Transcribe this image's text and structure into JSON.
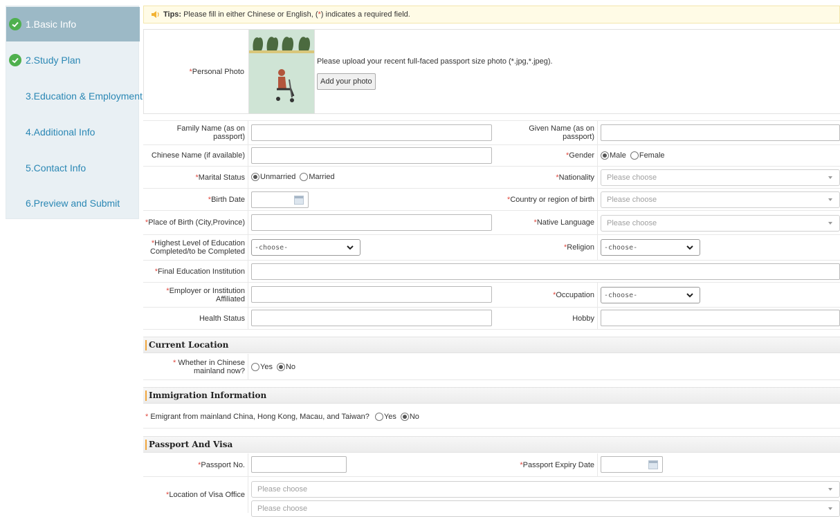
{
  "sidebar": {
    "items": [
      {
        "label": "1.Basic Info",
        "done": true,
        "active": true
      },
      {
        "label": "2.Study Plan",
        "done": true,
        "active": false
      },
      {
        "label": "3.Education & Employment",
        "done": false,
        "active": false
      },
      {
        "label": "4.Additional Info",
        "done": false,
        "active": false
      },
      {
        "label": "5.Contact Info",
        "done": false,
        "active": false
      },
      {
        "label": "6.Preview and Submit",
        "done": false,
        "active": false
      }
    ]
  },
  "tips": {
    "label": "Tips:",
    "text_before": "Please fill in either Chinese or English, (",
    "star": "*",
    "text_after": ") indicates a required field."
  },
  "required_marker": "*",
  "photo": {
    "label": "Personal Photo",
    "instruction": "Please upload your recent full-faced passport size photo (*.jpg,*.jpeg).",
    "button": "Add your photo"
  },
  "form": {
    "family_name": {
      "label": "Family Name (as on passport)",
      "value": ""
    },
    "given_name": {
      "label": "Given Name (as on passport)",
      "value": ""
    },
    "chinese_name": {
      "label": "Chinese Name (if available)",
      "value": ""
    },
    "gender": {
      "label": "Gender",
      "options": [
        "Male",
        "Female"
      ],
      "selected": "Male"
    },
    "marital_status": {
      "label": "Marital Status",
      "options": [
        "Unmarried",
        "Married"
      ],
      "selected": "Unmarried"
    },
    "nationality": {
      "label": "Nationality",
      "placeholder": "Please choose"
    },
    "birth_date": {
      "label": "Birth Date",
      "value": ""
    },
    "country_of_birth": {
      "label": "Country or region of birth",
      "placeholder": "Please choose"
    },
    "place_of_birth": {
      "label": "Place of Birth (City,Province)",
      "value": ""
    },
    "native_language": {
      "label": "Native Language",
      "placeholder": "Please choose"
    },
    "education_level": {
      "label": "Highest Level of Education Completed/to be Completed",
      "value": "-choose-"
    },
    "religion": {
      "label": "Religion",
      "value": "-choose-"
    },
    "final_institution": {
      "label": "Final Education Institution",
      "value": ""
    },
    "employer": {
      "label": "Employer or Institution Affiliated",
      "value": ""
    },
    "occupation": {
      "label": "Occupation",
      "value": "-choose-"
    },
    "health_status": {
      "label": "Health Status",
      "value": ""
    },
    "hobby": {
      "label": "Hobby",
      "value": ""
    }
  },
  "current_location": {
    "title": "Current Location",
    "question": "Whether in Chinese mainland now?",
    "options": [
      "Yes",
      "No"
    ],
    "selected": "No"
  },
  "immigration": {
    "title": "Immigration Information",
    "question": "Emigrant from mainland China, Hong Kong, Macau, and Taiwan?",
    "options": [
      "Yes",
      "No"
    ],
    "selected": "No"
  },
  "passport": {
    "title": "Passport And Visa",
    "passport_no": {
      "label": "Passport No.",
      "value": ""
    },
    "expiry": {
      "label": "Passport Expiry Date",
      "value": ""
    },
    "visa_office": {
      "label": "Location of Visa Office",
      "placeholder_1": "Please choose",
      "placeholder_2": "Please choose"
    }
  }
}
